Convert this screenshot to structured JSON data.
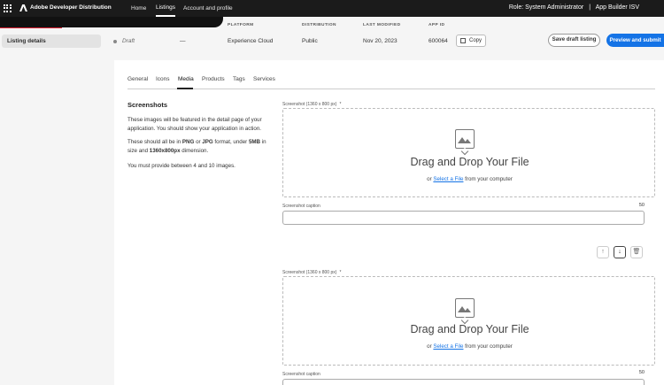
{
  "topbar": {
    "brand": "Adobe Developer Distribution",
    "nav": [
      "Home",
      "Listings",
      "Account and profile"
    ],
    "active_nav": "Listings",
    "role": "Role: System Administrator",
    "separator": "|",
    "org": "App Builder ISV"
  },
  "columns": {
    "platform_h": "PLATFORM",
    "distribution_h": "DISTRIBUTION",
    "last_modified_h": "LAST MODIFIED",
    "app_id_h": "APP ID"
  },
  "listing": {
    "status": "Draft",
    "dash": "—",
    "platform": "Experience Cloud",
    "distribution": "Public",
    "last_modified": "Nov 20, 2023",
    "app_id": "600064",
    "copy_label": "Copy"
  },
  "sidebar": {
    "item": "Listing details"
  },
  "actions": {
    "save_draft": "Save draft listing",
    "preview_submit": "Preview and submit"
  },
  "tabs": [
    "General",
    "Icons",
    "Media",
    "Products",
    "Tags",
    "Services"
  ],
  "active_tab": "Media",
  "screenshots": {
    "title": "Screenshots",
    "p1": "These images will be featured in the detail page of your application. You should show your application in action.",
    "p2_a": "These should all be in ",
    "p2_png": "PNG",
    "p2_b": " or ",
    "p2_jpg": "JPG",
    "p2_c": " format, under ",
    "p2_size": "5MB",
    "p2_d": " in size and ",
    "p2_dim": "1360x800px",
    "p2_e": " dimension.",
    "p3": "You must provide between 4 and 10 images."
  },
  "uploads": [
    {
      "label": "Screenshot (1360 x 800 px)",
      "required": "*",
      "drop_title": "Drag and Drop Your File",
      "or": "or ",
      "select": "Select a File",
      "from": " from your computer",
      "caption_label": "Screenshot caption",
      "caption_max": "50"
    },
    {
      "label": "Screenshot (1360 x 800 px)",
      "required": "*",
      "drop_title": "Drag and Drop Your File",
      "or": "or ",
      "select": "Select a File",
      "from": " from your computer",
      "caption_label": "Screenshot caption",
      "caption_max": "50"
    }
  ],
  "reorder": {
    "up": "↑",
    "down": "↓",
    "delete": "🗑"
  }
}
